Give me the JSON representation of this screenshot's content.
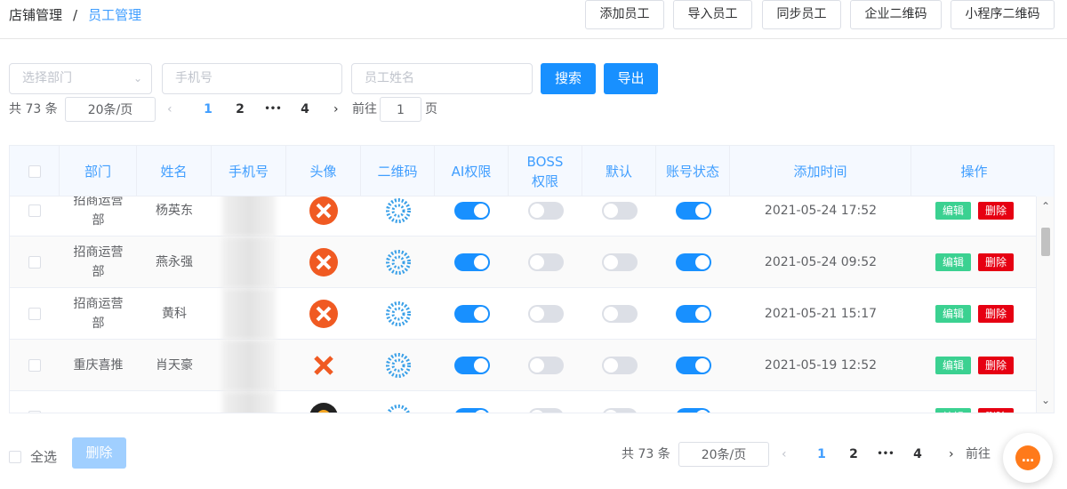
{
  "breadcrumb": {
    "root": "店铺管理",
    "separator": "/",
    "current": "员工管理"
  },
  "toolbar": [
    {
      "label": "添加员工"
    },
    {
      "label": "导入员工"
    },
    {
      "label": "同步员工"
    },
    {
      "label": "企业二维码"
    },
    {
      "label": "小程序二维码"
    }
  ],
  "filters": {
    "department_placeholder": "选择部门",
    "phone_placeholder": "手机号",
    "name_placeholder": "员工姓名",
    "search_label": "搜索",
    "export_label": "导出"
  },
  "pagination": {
    "total": "共 73 条",
    "page_size": "20条/页",
    "pages": [
      "1",
      "2",
      "•••",
      "4"
    ],
    "active_page": "1",
    "goto_label": "前往",
    "goto_value": "1",
    "goto_suffix": "页"
  },
  "table": {
    "headers": [
      "部门",
      "姓名",
      "手机号",
      "头像",
      "二维码",
      "AI权限",
      "BOSS权限",
      "默认",
      "账号状态",
      "添加时间",
      "操作"
    ],
    "rows": [
      {
        "department": "招商运营部",
        "name": "杨英东",
        "ai": true,
        "boss": false,
        "default": false,
        "status": true,
        "time": "2021-05-24 17:52"
      },
      {
        "department": "招商运营部",
        "name": "燕永强",
        "ai": true,
        "boss": false,
        "default": false,
        "status": true,
        "time": "2021-05-24 09:52"
      },
      {
        "department": "招商运营部",
        "name": "黄科",
        "ai": true,
        "boss": false,
        "default": false,
        "status": true,
        "time": "2021-05-21 15:17"
      },
      {
        "department": "重庆喜推",
        "name": "肖天豪",
        "ai": true,
        "boss": false,
        "default": false,
        "status": true,
        "time": "2021-05-19 12:52"
      },
      {
        "department": "",
        "name": "",
        "ai": true,
        "boss": false,
        "default": false,
        "status": true,
        "time": ""
      }
    ],
    "edit_label": "编辑",
    "delete_label": "删除"
  },
  "footer": {
    "select_all": "全选",
    "delete_label": "删除"
  },
  "colors": {
    "accent": "#1890ff",
    "edit": "#3bd191",
    "delete": "#e60012",
    "header_bg": "#f5f9ff"
  }
}
